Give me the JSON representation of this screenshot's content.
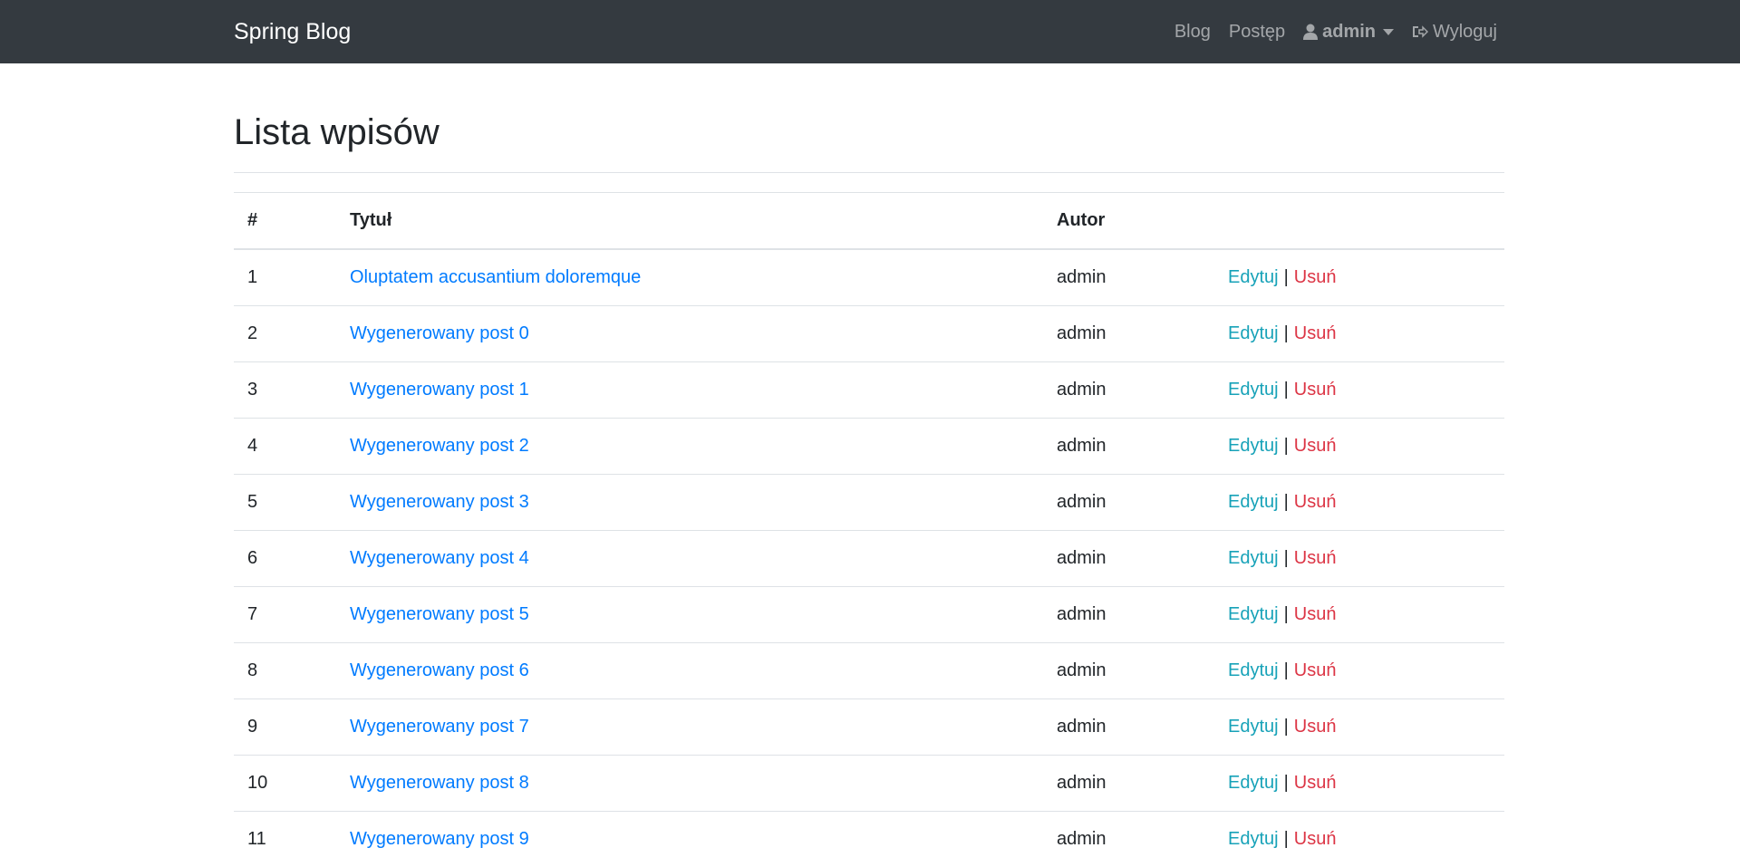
{
  "navbar": {
    "brand": "Spring Blog",
    "links": {
      "blog": "Blog",
      "progress": "Postęp",
      "user": "admin",
      "logout": "Wyloguj"
    },
    "icons": {
      "user": "user-icon",
      "logout": "sign-out-icon",
      "dropdown": "caret-down-icon"
    }
  },
  "page": {
    "title": "Lista wpisów"
  },
  "table": {
    "headers": {
      "num": "#",
      "title": "Tytuł",
      "author": "Autor",
      "actions": ""
    },
    "edit_label": "Edytuj",
    "delete_label": "Usuń",
    "separator": "|",
    "rows": [
      {
        "num": "1",
        "title": "Oluptatem accusantium doloremque",
        "author": "admin"
      },
      {
        "num": "2",
        "title": "Wygenerowany post 0",
        "author": "admin"
      },
      {
        "num": "3",
        "title": "Wygenerowany post 1",
        "author": "admin"
      },
      {
        "num": "4",
        "title": "Wygenerowany post 2",
        "author": "admin"
      },
      {
        "num": "5",
        "title": "Wygenerowany post 3",
        "author": "admin"
      },
      {
        "num": "6",
        "title": "Wygenerowany post 4",
        "author": "admin"
      },
      {
        "num": "7",
        "title": "Wygenerowany post 5",
        "author": "admin"
      },
      {
        "num": "8",
        "title": "Wygenerowany post 6",
        "author": "admin"
      },
      {
        "num": "9",
        "title": "Wygenerowany post 7",
        "author": "admin"
      },
      {
        "num": "10",
        "title": "Wygenerowany post 8",
        "author": "admin"
      },
      {
        "num": "11",
        "title": "Wygenerowany post 9",
        "author": "admin"
      }
    ]
  },
  "colors": {
    "navbar_bg": "#343a40",
    "link": "#007bff",
    "edit": "#17a2b8",
    "delete": "#dc3545"
  }
}
